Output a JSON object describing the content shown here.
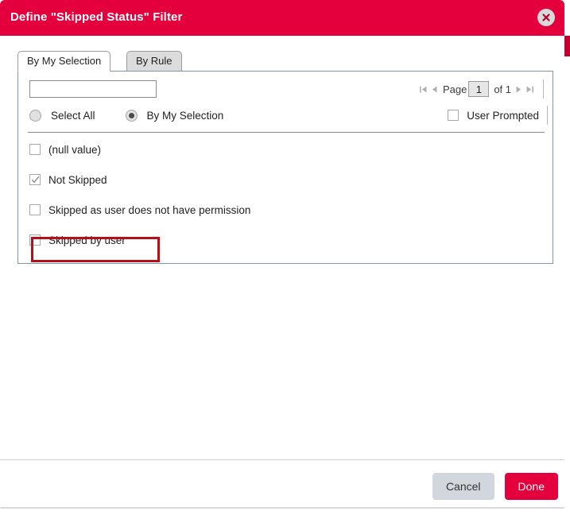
{
  "dialog": {
    "title": "Define \"Skipped Status\" Filter",
    "close_icon": "close-icon",
    "accent_color": "#e3003c",
    "highlight_color": "#b70f16"
  },
  "tabs": [
    {
      "label": "By My Selection",
      "active": true
    },
    {
      "label": "By Rule",
      "active": false
    }
  ],
  "search": {
    "value": "",
    "placeholder": ""
  },
  "pager": {
    "first_icon": "first-page-icon",
    "prev_icon": "previous-page-icon",
    "page_label": "Page",
    "page_value": "1",
    "of_label": "of 1",
    "next_icon": "next-page-icon",
    "last_icon": "last-page-icon"
  },
  "modes": [
    {
      "label": "Select All",
      "selected": false
    },
    {
      "label": "By My Selection",
      "selected": true
    }
  ],
  "user_prompted": {
    "label": "User Prompted",
    "checked": false
  },
  "options": [
    {
      "label": "(null value)",
      "checked": false
    },
    {
      "label": "Not Skipped",
      "checked": true,
      "highlighted": true
    },
    {
      "label": "Skipped as user does not have permission",
      "checked": false
    },
    {
      "label": "Skipped by user",
      "checked": false
    }
  ],
  "footer": {
    "cancel_label": "Cancel",
    "done_label": "Done"
  }
}
